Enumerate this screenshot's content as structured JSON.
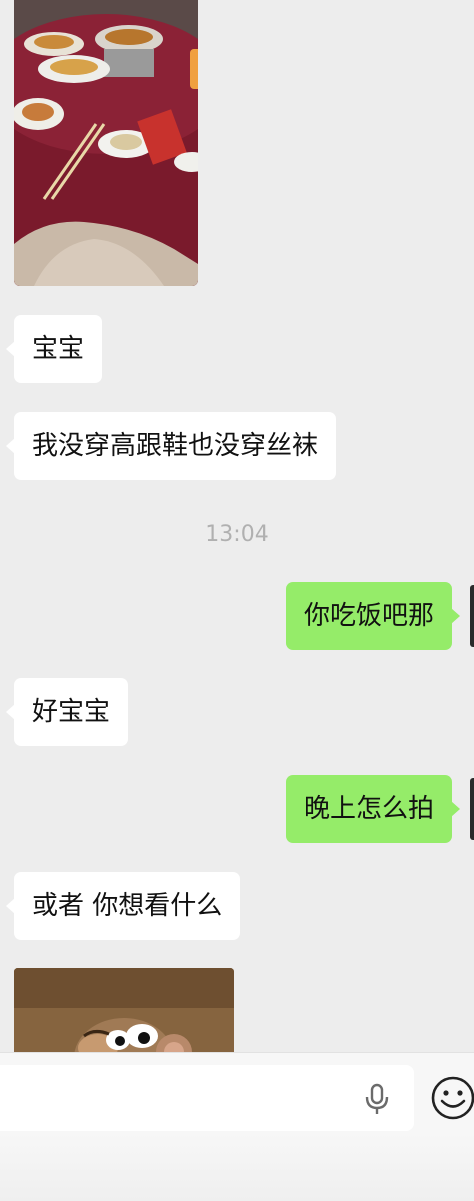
{
  "messages": [
    {
      "id": "m1",
      "side": "in",
      "text": "宝宝"
    },
    {
      "id": "m2",
      "side": "in",
      "text": "我没穿高跟鞋也没穿丝袜"
    },
    {
      "id": "m3",
      "side": "out",
      "text": "你吃饭吧那"
    },
    {
      "id": "m4",
      "side": "in",
      "text": "好宝宝"
    },
    {
      "id": "m5",
      "side": "out",
      "text": "晚上怎么拍"
    },
    {
      "id": "m6",
      "side": "in",
      "text": "或者 你想看什么"
    }
  ],
  "timestamp": "13:04",
  "colors": {
    "chat_background": "#ededed",
    "incoming_bubble": "#ffffff",
    "outgoing_bubble": "#95ec69",
    "timestamp_text": "#b0b0b0"
  },
  "icons": {
    "voice": "microphone-icon",
    "emoji": "smiley-icon"
  }
}
